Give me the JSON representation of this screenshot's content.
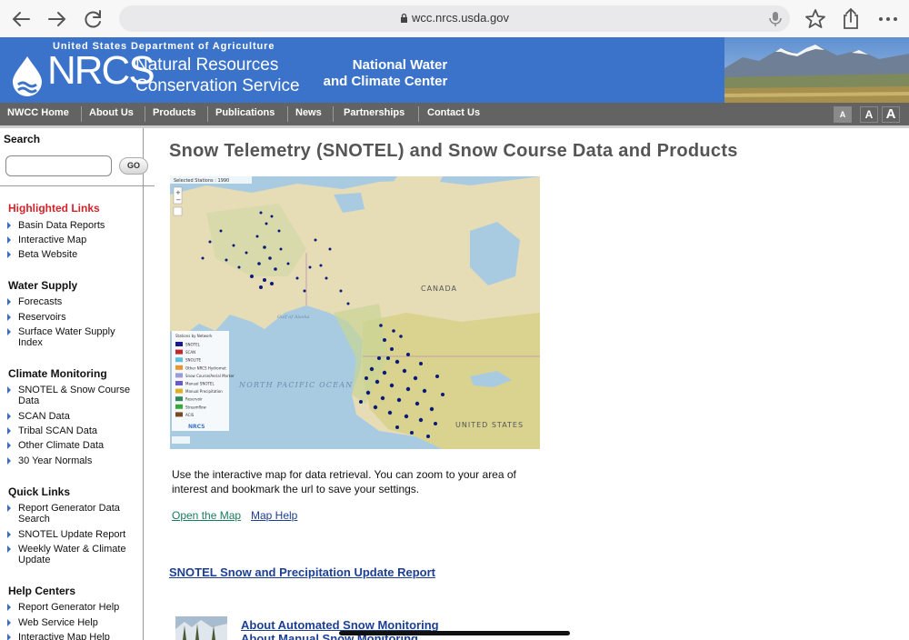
{
  "browser": {
    "url": "wcc.nrcs.usda.gov",
    "icons": [
      "back-icon",
      "forward-icon",
      "reload-icon",
      "lock-icon",
      "mic-icon",
      "bookmark-star-icon",
      "share-icon",
      "more-icon"
    ]
  },
  "banner": {
    "department": "United States Department of Agriculture",
    "acronym": "NRCS",
    "agency_line1": "Natural Resources",
    "agency_line2": "Conservation Service",
    "center_line1": "National Water",
    "center_line2": "and Climate Center",
    "colors": {
      "banner": "#3a73c9",
      "nav": "#636363"
    }
  },
  "nav": {
    "items": [
      "NWCC Home",
      "About Us",
      "Products",
      "Publications",
      "News",
      "Partnerships",
      "Contact Us"
    ],
    "font_sizes": [
      "A",
      "A",
      "A"
    ]
  },
  "sidebar": {
    "search_label": "Search",
    "search_value": "",
    "go_label": "GO",
    "sections": [
      {
        "title": "Highlighted Links",
        "items": [
          "Basin Data Reports",
          "Interactive Map",
          "Beta Website"
        ]
      },
      {
        "title": "Water Supply",
        "items": [
          "Forecasts",
          "Reservoirs",
          "Surface Water Supply Index"
        ]
      },
      {
        "title": "Climate Monitoring",
        "items": [
          "SNOTEL & Snow Course Data",
          "SCAN Data",
          "Tribal SCAN Data",
          "Other Climate Data",
          "30 Year Normals"
        ]
      },
      {
        "title": "Quick Links",
        "items": [
          "Report Generator Data Search",
          "SNOTEL Update Report",
          "Weekly Water & Climate Update"
        ]
      },
      {
        "title": "Help Centers",
        "items": [
          "Report Generator Help",
          "Web Service Help",
          "Interactive Map Help"
        ]
      }
    ]
  },
  "main": {
    "title": "Snow Telemetry (SNOTEL) and Snow Course Data and Products",
    "map": {
      "selected_stations": "Selected Stations : 1990",
      "labels": [
        "CANADA",
        "NORTH PACIFIC OCEAN",
        "UNITED STATES",
        "Gulf of Alaska"
      ],
      "legend_title": "Stations by Network",
      "legend": [
        {
          "name": "SNOTEL",
          "color": "#1a1a8c"
        },
        {
          "name": "SCAN",
          "color": "#c0282d"
        },
        {
          "name": "SNOLITE",
          "color": "#5bc0de"
        },
        {
          "name": "Other NRCS Hydromet",
          "color": "#e8952b"
        },
        {
          "name": "Snow Course/Aerial Marker",
          "color": "#9b9bd6"
        },
        {
          "name": "Manual SNOTEL",
          "color": "#6a5acd"
        },
        {
          "name": "Manual Precipitation",
          "color": "#e0b020"
        },
        {
          "name": "Reservoir",
          "color": "#2e8b57"
        },
        {
          "name": "Streamflow",
          "color": "#38a83a"
        },
        {
          "name": "ACIS",
          "color": "#7a4a1e"
        }
      ],
      "legend_logo": "NRCS"
    },
    "description": "Use the interactive map for data retrieval. You can zoom to your area of interest and bookmark the url to save your settings.",
    "open_map": "Open the Map",
    "map_help": "Map Help",
    "update_report": "SNOTEL Snow and Precipitation Update Report",
    "about_automated": "About Automated Snow Monitoring",
    "about_manual": "About Manual Snow Monitoring"
  }
}
